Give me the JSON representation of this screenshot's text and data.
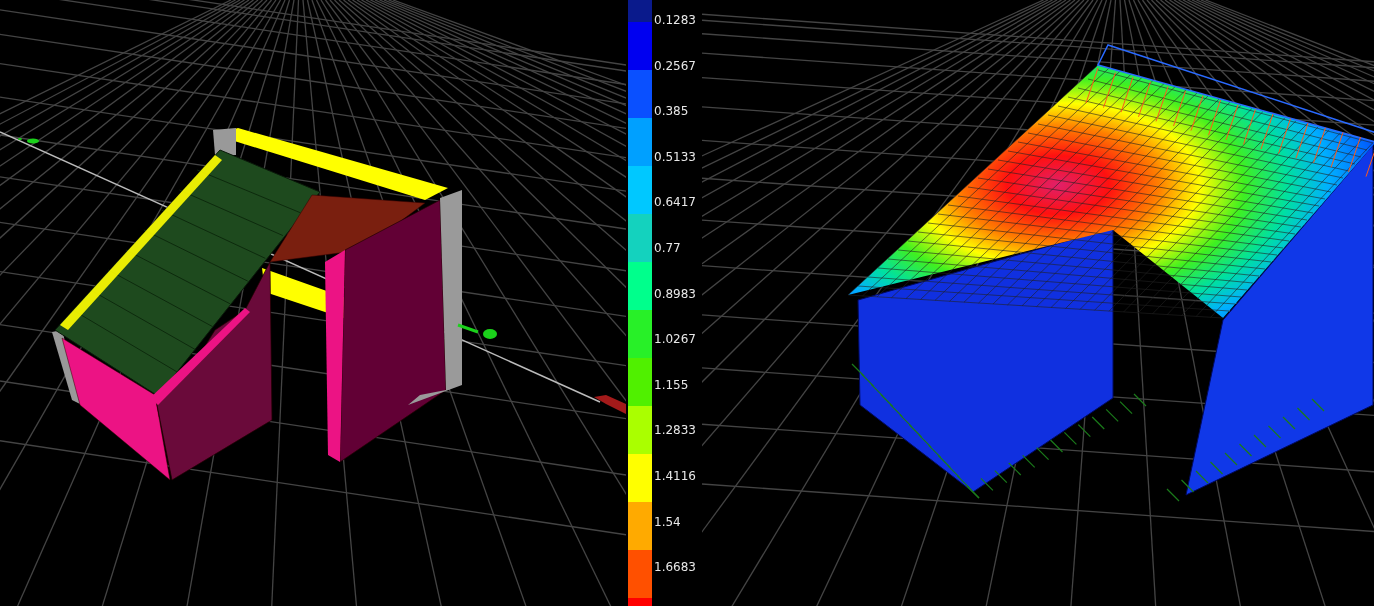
{
  "legend": {
    "bands": [
      {
        "color": "#0a1a8c",
        "label": "0.1283"
      },
      {
        "color": "#0000f0",
        "label": "0.2567"
      },
      {
        "color": "#0a50ff",
        "label": "0.385"
      },
      {
        "color": "#00a0ff",
        "label": "0.5133"
      },
      {
        "color": "#00c8ff",
        "label": "0.6417"
      },
      {
        "color": "#14d2be",
        "label": "0.77"
      },
      {
        "color": "#00ff8c",
        "label": "0.8983"
      },
      {
        "color": "#28f028",
        "label": "1.0267"
      },
      {
        "color": "#50f000",
        "label": "1.155"
      },
      {
        "color": "#aaff00",
        "label": "1.2833"
      },
      {
        "color": "#ffff00",
        "label": "1.4116"
      },
      {
        "color": "#ffaa00",
        "label": "1.54"
      },
      {
        "color": "#ff5000",
        "label": "1.6683"
      },
      {
        "color": "#ff0000"
      }
    ]
  }
}
